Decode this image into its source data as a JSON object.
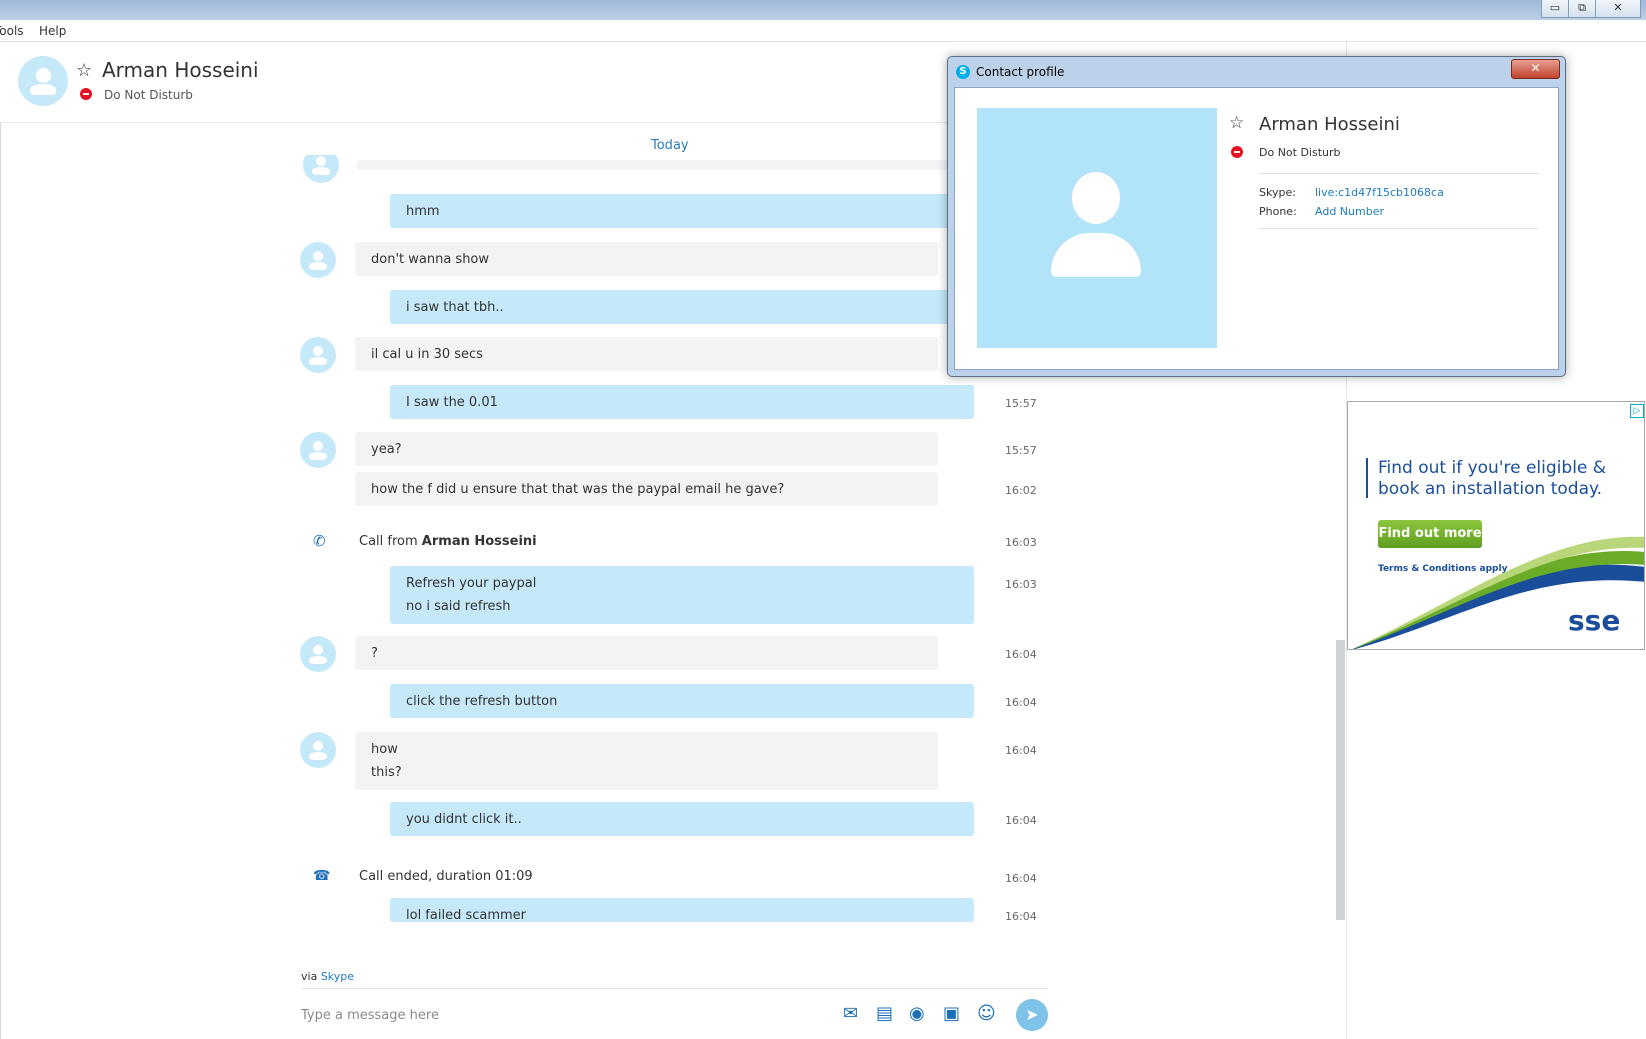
{
  "menu": {
    "tools": "Tools",
    "help": "Help"
  },
  "window_controls": {
    "minimize": "▭",
    "restore": "⧉",
    "close": "✕"
  },
  "header": {
    "name": "Arman Hosseini",
    "status": "Do Not Disturb"
  },
  "chat": {
    "date_divider": "Today",
    "messages": [
      {
        "from": "mine",
        "lines": [
          "hmm"
        ],
        "time": ""
      },
      {
        "from": "them",
        "lines": [
          "don't wanna show"
        ],
        "time": ""
      },
      {
        "from": "mine",
        "lines": [
          "i saw that tbh.."
        ],
        "time": ""
      },
      {
        "from": "them",
        "lines": [
          "il cal u in 30 secs"
        ],
        "time": ""
      },
      {
        "from": "mine",
        "lines": [
          "I saw the 0.01"
        ],
        "time": "15:57"
      },
      {
        "from": "them",
        "lines": [
          "yea?"
        ],
        "time": "15:57"
      },
      {
        "from": "them",
        "lines": [
          "how the f did u ensure that that was the paypal email he gave?"
        ],
        "time": "16:02"
      },
      {
        "from": "mine",
        "lines": [
          "Refresh your paypal",
          "no i said refresh"
        ],
        "time": "16:03"
      },
      {
        "from": "them",
        "lines": [
          "?"
        ],
        "time": "16:04"
      },
      {
        "from": "mine",
        "lines": [
          "click the refresh button"
        ],
        "time": "16:04"
      },
      {
        "from": "them",
        "lines": [
          "how",
          "this?"
        ],
        "time": "16:04"
      },
      {
        "from": "mine",
        "lines": [
          "you didnt click it.."
        ],
        "time": "16:04"
      },
      {
        "from": "mine",
        "lines": [
          "lol failed scammer"
        ],
        "time": "16:04"
      }
    ],
    "call_from": {
      "prefix": "Call from ",
      "name": "Arman Hosseini",
      "time": "16:03",
      "icon": "incoming-call-icon"
    },
    "call_ended": {
      "text": "Call ended, duration 01:09",
      "time": "16:04",
      "icon": "call-ended-icon"
    }
  },
  "compose": {
    "via_prefix": "via ",
    "via_link": "Skype",
    "placeholder": "Type a message here",
    "toolbar_icons": [
      "send-contacts-icon",
      "send-file-icon",
      "video-message-icon",
      "contact-card-icon",
      "emoticon-icon"
    ],
    "send_icon": "send-icon"
  },
  "contact_profile": {
    "title": "Contact profile",
    "close": "✕",
    "name": "Arman Hosseini",
    "status": "Do Not Disturb",
    "skype_label": "Skype:",
    "skype_value": "live:c1d47f15cb1068ca",
    "phone_label": "Phone:",
    "phone_value": "Add Number"
  },
  "ad": {
    "headline": "Find out if you're eligible & book an installation today.",
    "button": "Find out more",
    "terms": "Terms & Conditions apply",
    "logo": "sse",
    "choices": "▷"
  },
  "colors": {
    "accent": "#2a7dc0",
    "mine_bubble": "#c5e9f9",
    "their_bubble": "#f1f3f5",
    "dnd": "#e81123",
    "ad_blue": "#1a4e9b",
    "ad_green": "#6aab28"
  }
}
